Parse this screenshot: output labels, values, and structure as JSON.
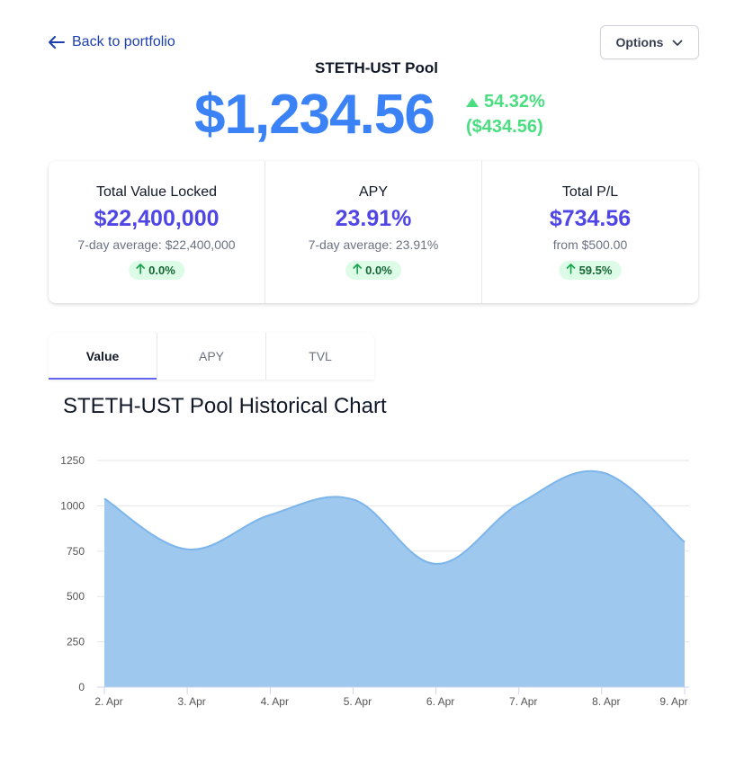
{
  "nav": {
    "back_label": "Back to portfolio",
    "options_label": "Options"
  },
  "header": {
    "pool_name": "STETH-UST Pool",
    "value": "$1,234.56",
    "change_pct": "54.32%",
    "change_abs": "($434.56)"
  },
  "stats": [
    {
      "label": "Total Value Locked",
      "value": "$22,400,000",
      "sub": "7-day average: $22,400,000",
      "badge": "0.0%"
    },
    {
      "label": "APY",
      "value": "23.91%",
      "sub": "7-day average: 23.91%",
      "badge": "0.0%"
    },
    {
      "label": "Total P/L",
      "value": "$734.56",
      "sub": "from $500.00",
      "badge": "59.5%"
    }
  ],
  "tabs": [
    {
      "label": "Value",
      "active": true
    },
    {
      "label": "APY",
      "active": false
    },
    {
      "label": "TVL",
      "active": false
    }
  ],
  "colors": {
    "accent": "#3b82f6",
    "positive": "#4ade80",
    "stat_value": "#4f46e5",
    "area_fill": "#9ec8ee",
    "area_line": "#7cb5ec"
  },
  "chart_data": {
    "type": "area",
    "title": "STETH-UST Pool Historical Chart",
    "categories": [
      "2. Apr",
      "3. Apr",
      "4. Apr",
      "5. Apr",
      "6. Apr",
      "7. Apr",
      "8. Apr",
      "9. Apr"
    ],
    "values": [
      1040,
      760,
      950,
      1035,
      680,
      1010,
      1185,
      800
    ],
    "y_ticks": [
      "0",
      "250",
      "500",
      "750",
      "1000",
      "1250"
    ],
    "ylim": [
      0,
      1250
    ],
    "grid": true
  }
}
